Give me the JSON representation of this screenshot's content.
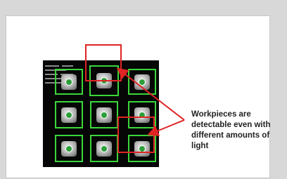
{
  "caption": {
    "line1": "Workpieces are",
    "line2": "detectable even with",
    "line3": "different amounts of",
    "line4": "light"
  },
  "colors": {
    "detect_box": "#3bd63b",
    "highlight_box": "#e02424",
    "arrow": "#e02424",
    "panel_bg": "#ffffff",
    "page_bg": "#d8d8d8",
    "camera_bg": "#060606"
  },
  "grid": {
    "rows": 3,
    "cols": 3,
    "highlighted_cells": [
      "r1c2",
      "r3c3"
    ]
  },
  "icons": [
    "workpiece-icon",
    "arrow-icon"
  ]
}
